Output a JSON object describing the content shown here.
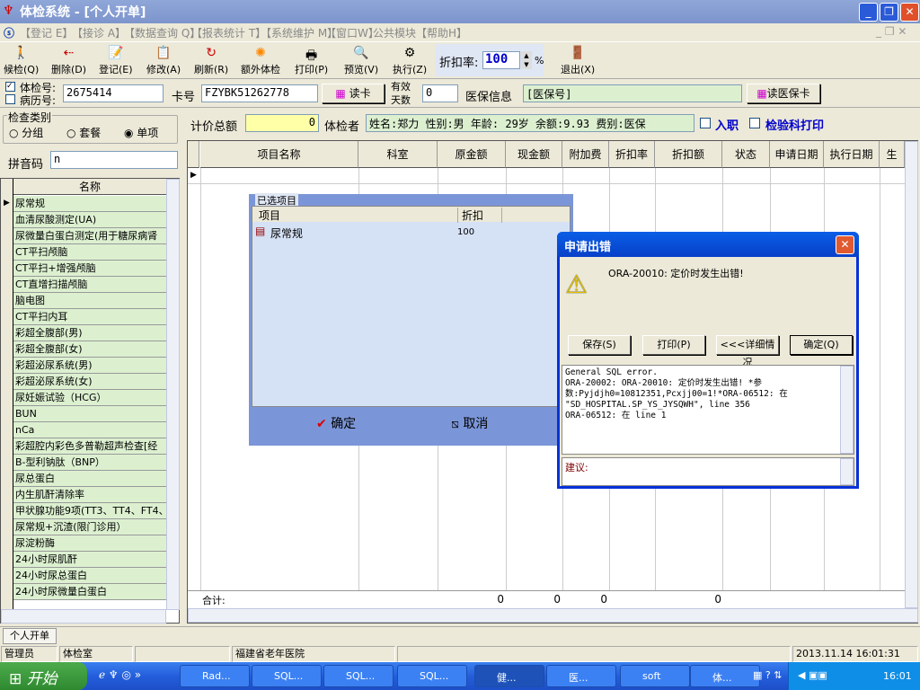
{
  "window": {
    "title": "体检系统 - [个人开单]"
  },
  "menu": [
    "【登记 E】",
    "【接诊 A】",
    "【数据查询 Q】",
    "【报表统计 T】",
    "【系统维护 M】",
    "【窗口W】",
    "公共模块",
    "【帮助H】"
  ],
  "toolbar": {
    "buttons": [
      {
        "label": "候检(Q)",
        "icon": "walk-icon"
      },
      {
        "label": "删除(D)",
        "icon": "delete-icon"
      },
      {
        "label": "登记(E)",
        "icon": "register-icon"
      },
      {
        "label": "修改(A)",
        "icon": "edit-icon"
      },
      {
        "label": "刷新(R)",
        "icon": "refresh-icon"
      },
      {
        "label": "额外体检",
        "icon": "sun-icon"
      },
      {
        "label": "打印(P)",
        "icon": "printer-icon"
      },
      {
        "label": "预览(V)",
        "icon": "preview-icon"
      },
      {
        "label": "执行(Z)",
        "icon": "gear-icon"
      }
    ],
    "discount_label": "折扣率:",
    "discount_value": "100",
    "percent": "%",
    "exit_label": "退出(X)"
  },
  "patient": {
    "exam_no_label": "体检号:",
    "exam_no_checked": true,
    "record_no_label": "病历号:",
    "exam_no": "2675414",
    "card_label": "卡号",
    "card_no": "FZYBK51262778",
    "read_card": "读卡",
    "valid_days_label1": "有效",
    "valid_days_label2": "天数",
    "valid_days": "0",
    "insurance_label": "医保信息",
    "insurance_value": "[医保号]",
    "read_insurance": "读医保卡"
  },
  "category": {
    "title": "检查类别",
    "options": [
      "分组",
      "套餐",
      "单项"
    ],
    "selected": "单项",
    "pinyin_label": "拼音码",
    "pinyin_value": "n"
  },
  "item_list": {
    "header": "名称",
    "items": [
      "尿常规",
      "血清尿酸测定(UA)",
      "尿微量白蛋白测定(用于糖尿病肾",
      "CT平扫颅脑",
      "CT平扫+增强颅脑",
      "CT直增扫描颅脑",
      "脑电图",
      "CT平扫内耳",
      "彩超全腹部(男)",
      "彩超全腹部(女)",
      "彩超泌尿系统(男)",
      "彩超泌尿系统(女)",
      "尿妊娠试验（HCG）",
      "BUN",
      "nCa",
      "彩超腔内彩色多普勒超声检查[经",
      "B-型利钠肽（BNP）",
      "尿总蛋白",
      "内生肌酐清除率",
      "甲状腺功能9项(TT3、TT4、FT4、",
      "尿常规+沉渣(限门诊用）",
      "尿淀粉酶",
      "24小时尿肌酐",
      "24小时尿总蛋白",
      "24小时尿微量白蛋白"
    ]
  },
  "summary": {
    "total_label": "计价总额",
    "total_value": "0",
    "examinee_label": "体检者",
    "examinee_info": "姓名:郑力 性别:男 年龄: 29岁 余额:9.93 费别:医保",
    "entry_label": "入职",
    "lab_print_label": "检验科打印"
  },
  "grid": {
    "columns": [
      "项目名称",
      "科室",
      "原金额",
      "现金额",
      "附加费",
      "折扣率",
      "折扣额",
      "状态",
      "申请日期",
      "执行日期",
      "生"
    ],
    "total_label": "合计:",
    "totals": [
      "0",
      "0",
      "0",
      "0"
    ]
  },
  "selected_panel": {
    "title": "已选项目",
    "col_item": "项目",
    "col_discount": "折扣",
    "rows": [
      {
        "item": "尿常规",
        "discount": "100"
      }
    ],
    "ok": "确定",
    "cancel": "取消"
  },
  "error_dialog": {
    "title": "申请出错",
    "message": "ORA-20010: 定价时发生出错!",
    "buttons": [
      "保存(S)",
      "打印(P)",
      "<<<详细情况",
      "确定(Q)"
    ],
    "details": [
      "General SQL error.",
      "ORA-20002: ORA-20010: 定价时发生出错! *参",
      "数:Pyjdjh0=10812351,Pcxjj00=1!*ORA-06512: 在",
      "\"SD_HOSPITAL.SP_YS_JYSQWH\", line 356",
      "ORA-06512: 在 line 1"
    ],
    "suggest_label": "建议:"
  },
  "tab": "个人开单",
  "statusbar": [
    "管理员",
    "体检室",
    "",
    "福建省老年医院",
    "",
    "2013.11.14 16:01:31"
  ],
  "taskbar": {
    "start": "开始",
    "tasks": [
      "Rad...",
      "SQL...",
      "SQL...",
      "SQL...",
      "健...",
      "医...",
      "soft",
      "体..."
    ],
    "clock": "16:01"
  }
}
